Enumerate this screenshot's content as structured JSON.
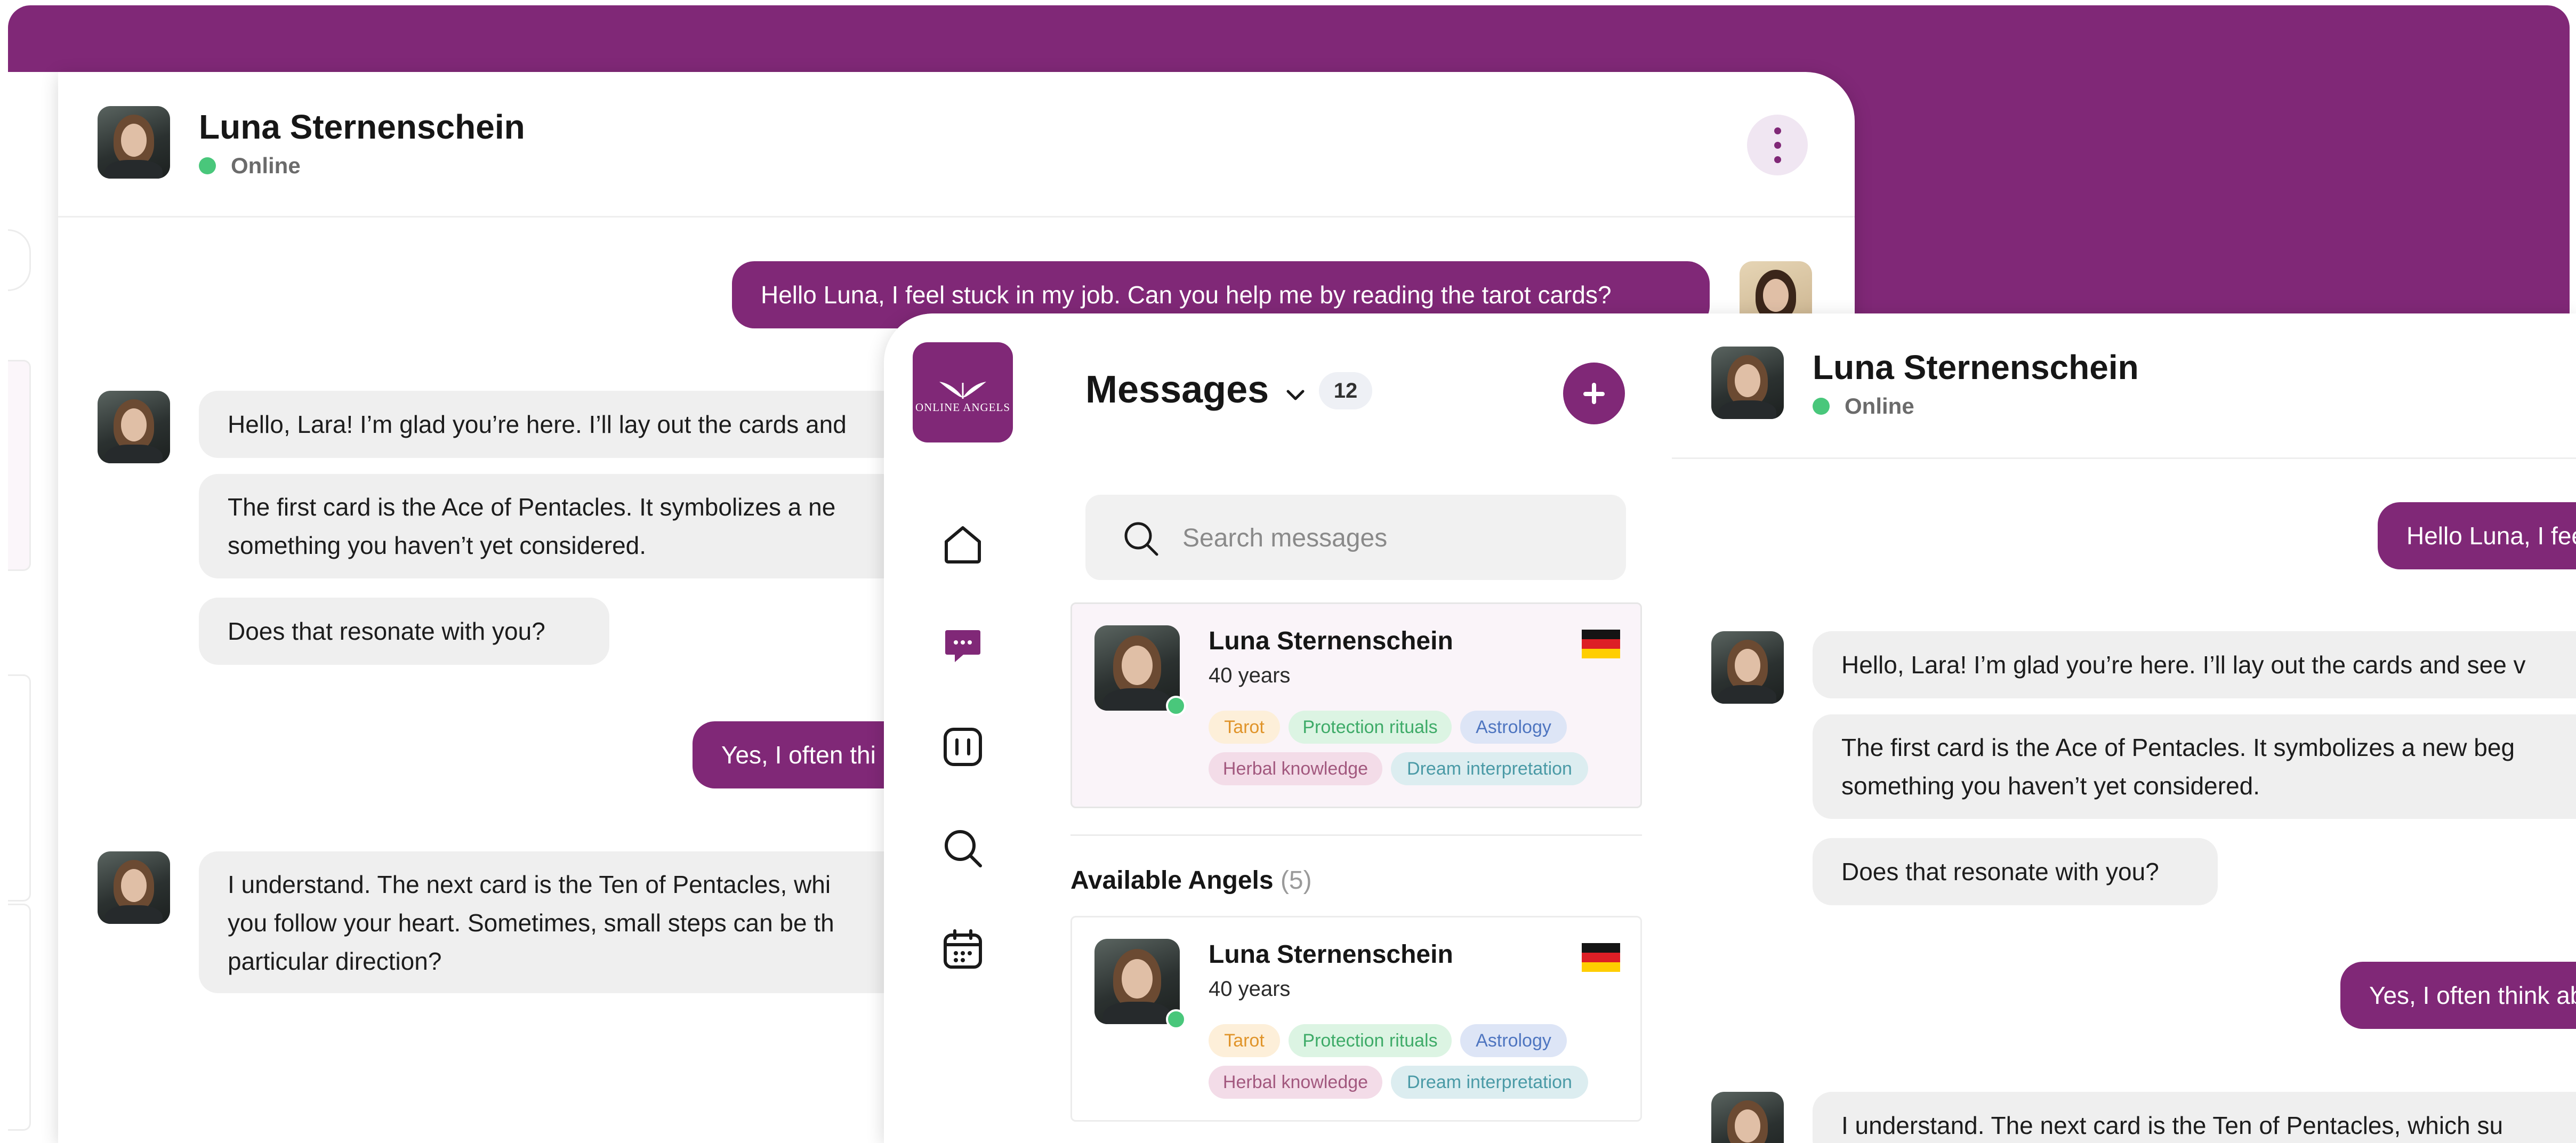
{
  "colors": {
    "brand": "#802877",
    "online": "#49c77b"
  },
  "contact": {
    "name": "Luna Sternenschein",
    "status": "Online"
  },
  "chat": {
    "user_message": "Hello Luna, I feel stuck in my job. Can you help me by reading the tarot cards?",
    "back_reply_1": "Hello, Lara! I’m glad you’re here. I’ll lay out the cards and",
    "back_reply_2_line1": "The first card is the Ace of Pentacles. It symbolizes a ne",
    "back_reply_2_line2": "something you haven’t yet considered.",
    "reply_3": "Does that resonate with you?",
    "back_user_2": "Yes, I often thi",
    "back_reply_4_line1": "I understand. The next card is the Ten of Pentacles, whi",
    "back_reply_4_line2": "you follow your heart. Sometimes, small steps can be th",
    "back_reply_4_line3": "particular direction?",
    "front_user_1": "Hello Luna, I fee",
    "front_reply_1": "Hello, Lara! I’m glad you’re here. I’ll lay out the cards and see v",
    "front_reply_2_line1": "The first card is the Ace of Pentacles. It symbolizes a new beg",
    "front_reply_2_line2": "something you haven’t yet considered.",
    "front_user_2": "Yes, I often think ab",
    "front_reply_4": "I understand. The next card is the Ten of Pentacles, which su"
  },
  "sidebar": {
    "logo_text": "ONLINE ANGELS",
    "icons": [
      "home-icon",
      "chat-icon",
      "cards-icon",
      "search-icon",
      "calendar-icon"
    ]
  },
  "messages_panel": {
    "title": "Messages",
    "count": "12",
    "search_placeholder": "Search messages",
    "section_title": "Available Angels",
    "section_count": "(5)"
  },
  "cards": [
    {
      "name": "Luna Sternenschein",
      "age": "40 years",
      "flag": "germany-flag",
      "tags": [
        "Tarot",
        "Protection rituals",
        "Astrology",
        "Herbal knowledge",
        "Dream interpretation"
      ]
    },
    {
      "name": "Luna Sternenschein",
      "age": "40 years",
      "flag": "germany-flag",
      "tags": [
        "Tarot",
        "Protection rituals",
        "Astrology",
        "Herbal knowledge",
        "Dream interpretation"
      ]
    }
  ]
}
